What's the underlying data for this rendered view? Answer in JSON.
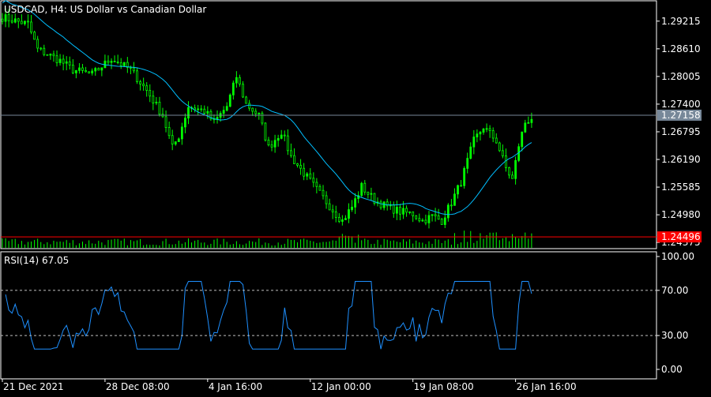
{
  "chart_data": {
    "type": "candlestick",
    "symbol_label": "USDCAD, H4:  US Dollar vs Canadian Dollar",
    "timeframe": "H4",
    "price_axis": {
      "ticks": [
        1.29215,
        1.2861,
        1.28005,
        1.274,
        1.26795,
        1.2619,
        1.25585,
        1.2498,
        1.24375
      ],
      "ylim": [
        1.2424,
        1.2966
      ]
    },
    "x_axis": {
      "labels": [
        "21 Dec 2021",
        "28 Dec 08:00",
        "4 Jan 16:00",
        "12 Jan 00:00",
        "19 Jan 08:00",
        "26 Jan 16:00"
      ],
      "bars_per_label": 32
    },
    "price_lines": [
      {
        "value": 1.27158,
        "label": "1.27158",
        "color": "#778899"
      },
      {
        "value": 1.24496,
        "label": "1.24496",
        "color": "#ff0000"
      }
    ],
    "close_anchors": [
      [
        0,
        1.293
      ],
      [
        8,
        1.2915
      ],
      [
        11,
        1.286
      ],
      [
        18,
        1.2835
      ],
      [
        22,
        1.2815
      ],
      [
        28,
        1.2805
      ],
      [
        34,
        1.284
      ],
      [
        40,
        1.2815
      ],
      [
        45,
        1.277
      ],
      [
        50,
        1.2715
      ],
      [
        53,
        1.2645
      ],
      [
        55,
        1.267
      ],
      [
        58,
        1.2735
      ],
      [
        63,
        1.2725
      ],
      [
        66,
        1.27
      ],
      [
        70,
        1.2735
      ],
      [
        73,
        1.28
      ],
      [
        76,
        1.274
      ],
      [
        80,
        1.2715
      ],
      [
        83,
        1.2645
      ],
      [
        87,
        1.268
      ],
      [
        90,
        1.2625
      ],
      [
        95,
        1.258
      ],
      [
        100,
        1.2535
      ],
      [
        104,
        1.25
      ],
      [
        106,
        1.2485
      ],
      [
        109,
        1.2515
      ],
      [
        112,
        1.256
      ],
      [
        116,
        1.253
      ],
      [
        120,
        1.2515
      ],
      [
        124,
        1.2505
      ],
      [
        128,
        1.25
      ],
      [
        131,
        1.2485
      ],
      [
        134,
        1.2495
      ],
      [
        137,
        1.2485
      ],
      [
        140,
        1.2525
      ],
      [
        143,
        1.257
      ],
      [
        147,
        1.266
      ],
      [
        150,
        1.269
      ],
      [
        154,
        1.266
      ],
      [
        157,
        1.26
      ],
      [
        159,
        1.2575
      ],
      [
        161,
        1.265
      ],
      [
        163,
        1.27
      ],
      [
        165,
        1.271
      ]
    ],
    "ma_color": "#00bfff",
    "candle_color": "#00ff00",
    "volume_color": "#00ff00",
    "rsi": {
      "label": "RSI(14) 67.05",
      "period": 14,
      "last_value": 67.05,
      "levels": [
        70,
        30
      ],
      "ticks": [
        100,
        70,
        30,
        0
      ],
      "tick_labels": [
        "100.00",
        "70.00",
        "30.00",
        "0.00"
      ],
      "ylim": [
        0,
        100
      ],
      "line_color": "#1e90ff"
    },
    "colors": {
      "background": "#000000",
      "frame": "#ffffff",
      "text": "#ffffff",
      "level_line": "#c0c0c0"
    }
  }
}
